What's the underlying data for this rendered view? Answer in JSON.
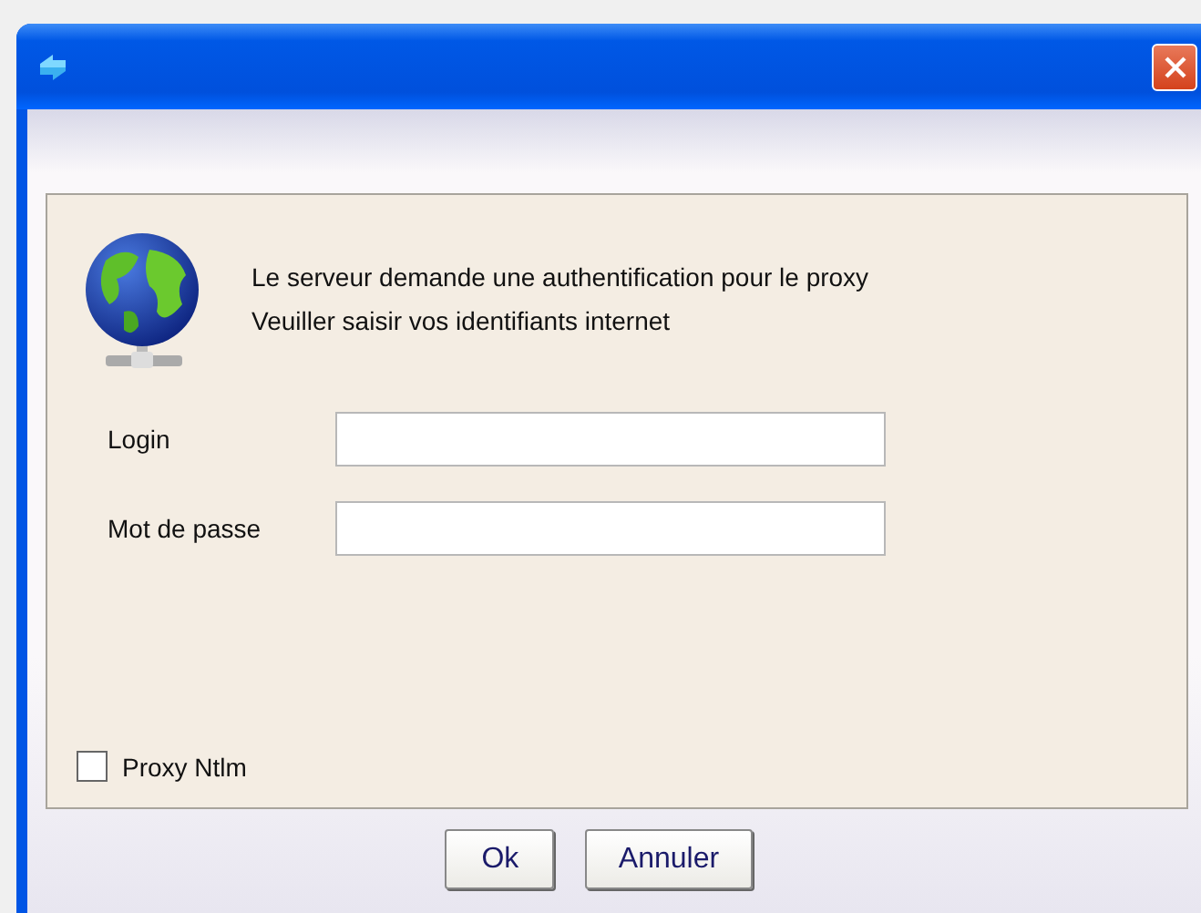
{
  "message": [
    "Le serveur demande une authentification pour le proxy",
    "Veuiller saisir vos identifiants internet"
  ],
  "fields": [
    {
      "label": "Login"
    },
    {
      "label": "Mot de passe"
    }
  ],
  "checkbox": {
    "label": "Proxy Ntlm",
    "checked": false
  },
  "buttons": [
    "Ok",
    "Annuler"
  ]
}
